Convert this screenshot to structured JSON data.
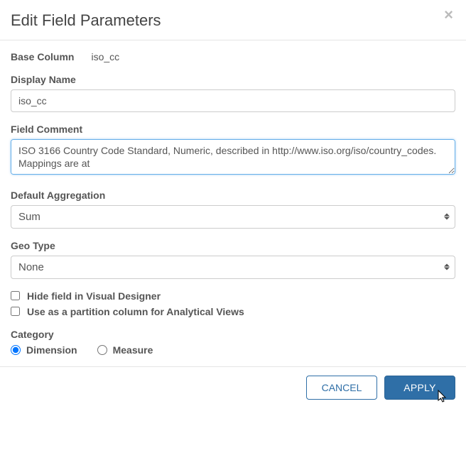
{
  "header": {
    "title": "Edit Field Parameters"
  },
  "base_column": {
    "label": "Base Column",
    "value": "iso_cc"
  },
  "display_name": {
    "label": "Display Name",
    "value": "iso_cc"
  },
  "field_comment": {
    "label": "Field Comment",
    "value": "ISO 3166 Country Code Standard, Numeric, described in http://www.iso.org/iso/country_codes. Mappings are at"
  },
  "default_aggregation": {
    "label": "Default Aggregation",
    "value": "Sum"
  },
  "geo_type": {
    "label": "Geo Type",
    "value": "None"
  },
  "checkboxes": {
    "hide_field": {
      "label": "Hide field in Visual Designer",
      "checked": false
    },
    "partition": {
      "label": "Use as a partition column for Analytical Views",
      "checked": false
    }
  },
  "category": {
    "label": "Category",
    "options": {
      "dimension": "Dimension",
      "measure": "Measure"
    },
    "selected": "dimension"
  },
  "footer": {
    "cancel": "CANCEL",
    "apply": "APPLY"
  }
}
